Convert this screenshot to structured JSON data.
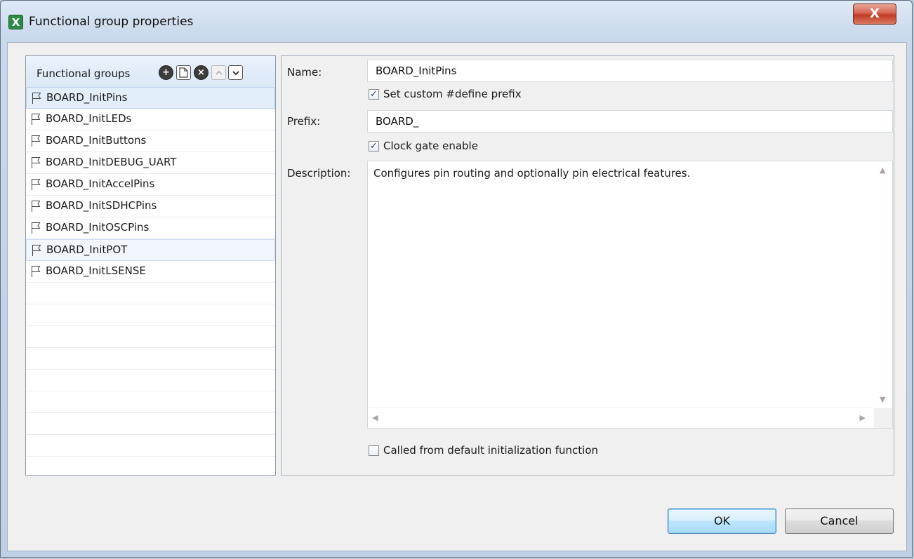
{
  "window": {
    "title": "Functional group properties",
    "icon_name": "app-x-icon",
    "icon_glyph": "X",
    "close_glyph": "X"
  },
  "groups": {
    "header_label": "Functional groups",
    "toolbar": {
      "add_icon": "add-circle-icon",
      "copy_icon": "copy-document-icon",
      "remove_icon": "remove-circle-icon",
      "move_up_icon": "chevron-up-icon",
      "move_down_icon": "chevron-down-icon"
    },
    "items": [
      {
        "label": "BOARD_InitPins"
      },
      {
        "label": "BOARD_InitLEDs"
      },
      {
        "label": "BOARD_InitButtons"
      },
      {
        "label": "BOARD_InitDEBUG_UART"
      },
      {
        "label": "BOARD_InitAccelPins"
      },
      {
        "label": "BOARD_InitSDHCPins"
      },
      {
        "label": "BOARD_InitOSCPins"
      },
      {
        "label": "BOARD_InitPOT"
      },
      {
        "label": "BOARD_InitLSENSE"
      }
    ],
    "selected_index": 0,
    "hover_index": 7
  },
  "props": {
    "name_label": "Name:",
    "name_value": "BOARD_InitPins",
    "custom_prefix_label": "Set custom #define prefix",
    "custom_prefix_checked": true,
    "prefix_label": "Prefix:",
    "prefix_value": "BOARD_",
    "clock_gate_label": "Clock gate enable",
    "clock_gate_checked": true,
    "description_label": "Description:",
    "description_value": "Configures pin routing and optionally pin electrical features.",
    "default_init_label": "Called from default initialization function",
    "default_init_checked": false
  },
  "buttons": {
    "ok": "OK",
    "cancel": "Cancel"
  }
}
